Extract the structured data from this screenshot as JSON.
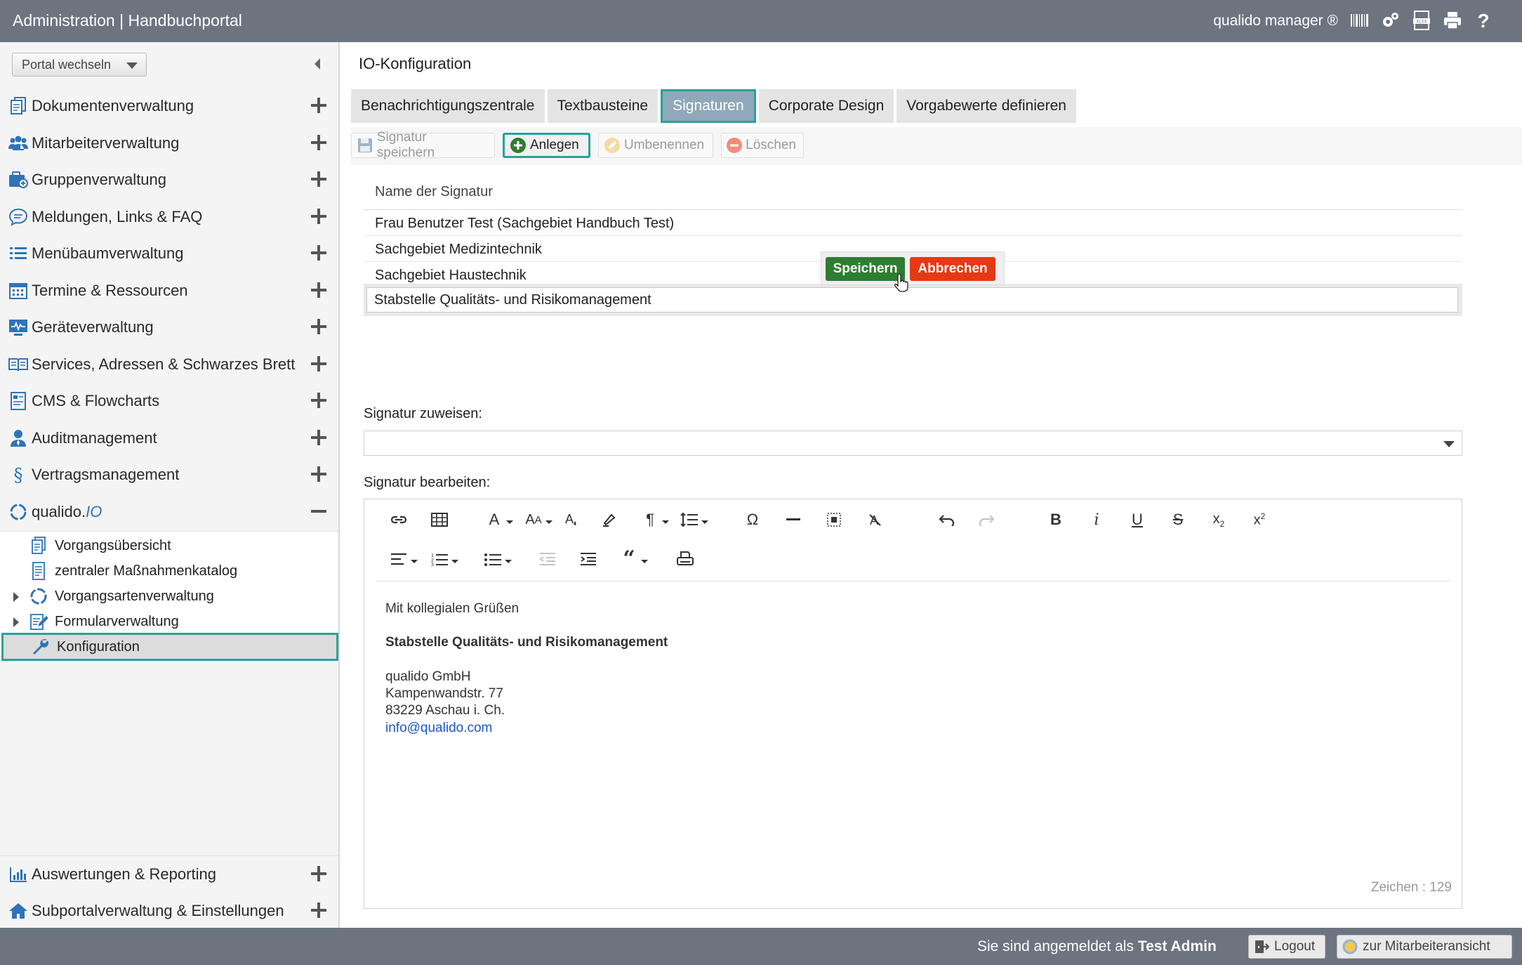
{
  "app": {
    "title": "Administration | Handbuchportal",
    "brand": "qualido manager ®"
  },
  "topbar_icons": [
    "barcode-icon",
    "settings-gears-icon",
    "xlsx-export-icon",
    "print-icon",
    "help-icon"
  ],
  "sidebar": {
    "portal_switch": "Portal wechseln",
    "items": [
      {
        "label": "Dokumentenverwaltung",
        "icon": "documents-icon"
      },
      {
        "label": "Mitarbeiterverwaltung",
        "icon": "users-icon"
      },
      {
        "label": "Gruppenverwaltung",
        "icon": "group-icon"
      },
      {
        "label": "Meldungen, Links & FAQ",
        "icon": "chat-icon"
      },
      {
        "label": "Menübaumverwaltung",
        "icon": "list-icon"
      },
      {
        "label": "Termine & Ressourcen",
        "icon": "calendar-icon"
      },
      {
        "label": "Geräteverwaltung",
        "icon": "device-icon"
      },
      {
        "label": "Services, Adressen & Schwarzes Brett",
        "icon": "book-icon"
      },
      {
        "label": "CMS & Flowcharts",
        "icon": "cms-icon"
      },
      {
        "label": "Auditmanagement",
        "icon": "auditor-icon"
      },
      {
        "label": "Vertragsmanagement",
        "icon": "paragraph-icon"
      }
    ],
    "io_section": {
      "label_prefix": "qualido.",
      "label_suffix": "IO",
      "children": [
        {
          "label": "Vorgangsübersicht",
          "icon": "document-icon"
        },
        {
          "label": "zentraler Maßnahmenkatalog",
          "icon": "catalog-icon"
        },
        {
          "label": "Vorgangsartenverwaltung",
          "icon": "cycle-icon"
        },
        {
          "label": "Formularverwaltung",
          "icon": "form-edit-icon"
        },
        {
          "label": "Konfiguration",
          "icon": "wrench-icon"
        }
      ]
    },
    "bottom_items": [
      {
        "label": "Auswertungen & Reporting",
        "icon": "bar-chart-icon"
      },
      {
        "label": "Subportalverwaltung & Einstellungen",
        "icon": "home-icon"
      }
    ]
  },
  "main": {
    "page_title": "IO-Konfiguration",
    "tabs": [
      {
        "label": "Benachrichtigungszentrale"
      },
      {
        "label": "Textbausteine"
      },
      {
        "label": "Signaturen"
      },
      {
        "label": "Corporate Design"
      },
      {
        "label": "Vorgabewerte definieren"
      }
    ],
    "active_tab": "Signaturen",
    "toolbar": {
      "save": "Signatur speichern",
      "create": "Anlegen",
      "rename": "Umbenennen",
      "delete": "Löschen"
    },
    "signature_table": {
      "header": "Name der Signatur",
      "rows": [
        "Frau Benutzer Test (Sachgebiet Handbuch Test)",
        "Sachgebiet Medizintechnik",
        "Sachgebiet Haustechnik"
      ],
      "edit_value": "Stabstelle Qualitäts- und Risikomanagement"
    },
    "popover": {
      "save": "Speichern",
      "cancel": "Abbrechen"
    },
    "assign": {
      "label": "Signatur zuweisen:",
      "value": ""
    },
    "editor": {
      "label": "Signatur bearbeiten:",
      "content": {
        "greeting": "Mit kollegialen Grüßen",
        "department": "Stabstelle Qualitäts- und Risikomanagement",
        "company": "qualido GmbH",
        "street": "Kampenwandstr. 77",
        "city": "83229 Aschau i. Ch.",
        "email": "info@qualido.com"
      },
      "char_count": "Zeichen : 129"
    }
  },
  "statusbar": {
    "logged_in_prefix": "Sie sind angemeldet als",
    "user": "Test Admin",
    "logout": "Logout",
    "employee_view": "zur Mitarbeiteransicht"
  },
  "colors": {
    "topbar": "#6c7480",
    "accent": "#2aa198",
    "save_green": "#2e7d32",
    "cancel_red": "#e53913",
    "icon_blue": "#2f73b8"
  }
}
